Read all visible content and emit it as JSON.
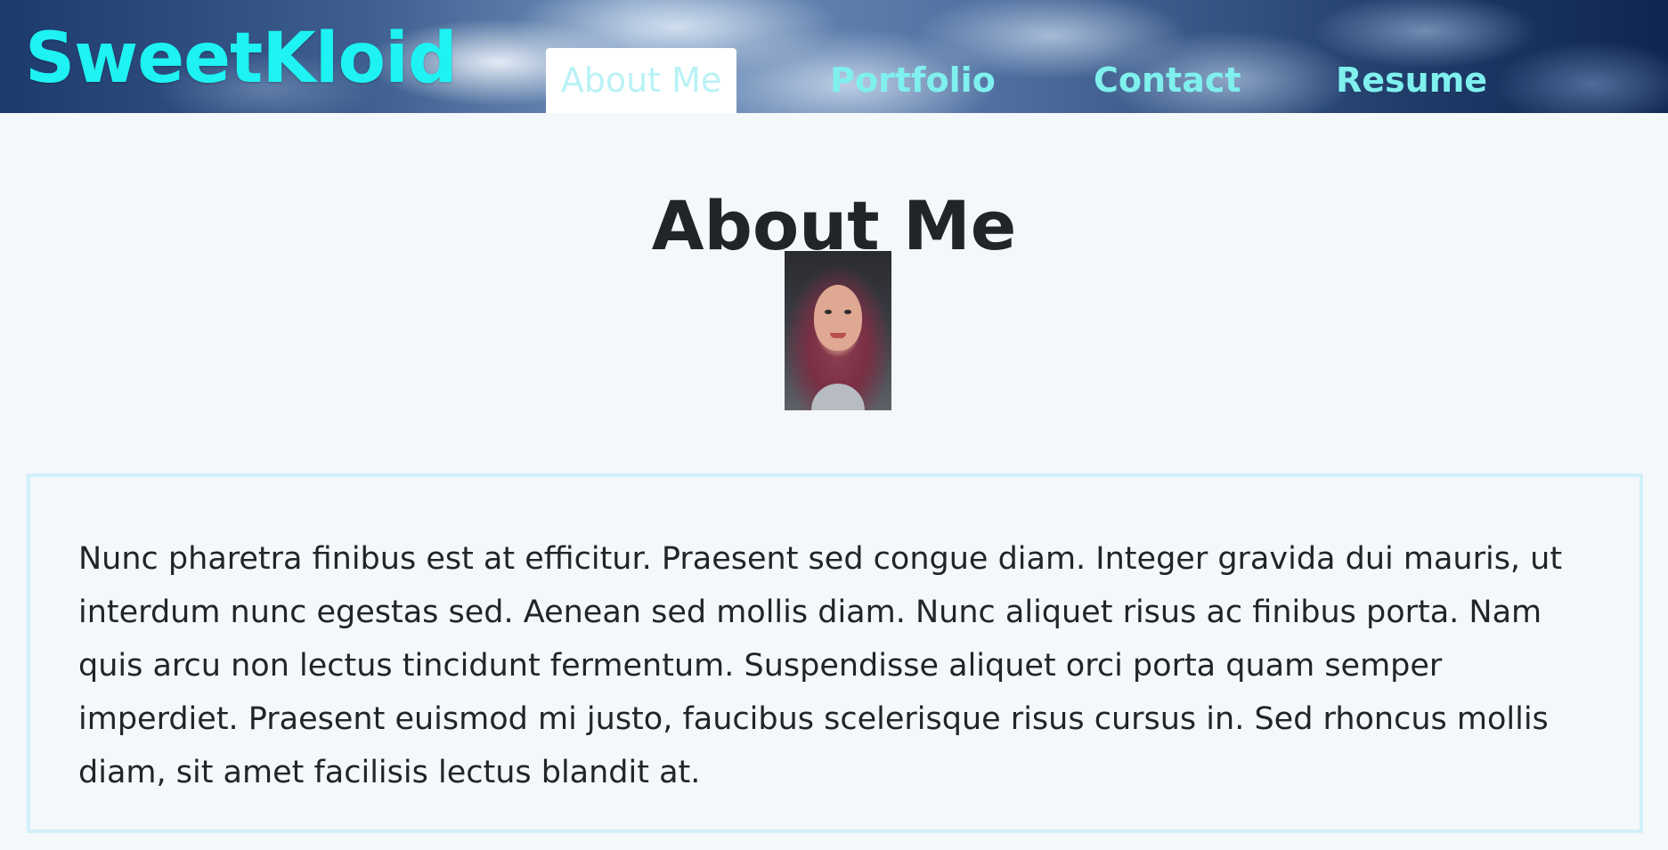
{
  "header": {
    "brand": "SweetKloid",
    "nav": [
      {
        "label": "About Me",
        "active": true
      },
      {
        "label": "Portfolio",
        "active": false
      },
      {
        "label": "Contact",
        "active": false
      },
      {
        "label": "Resume",
        "active": false
      }
    ]
  },
  "main": {
    "title": "About Me",
    "profile_image": "portrait-photo",
    "about_text": "Nunc pharetra finibus est at efficitur. Praesent sed congue diam. Integer gravida dui mauris, ut interdum nunc egestas sed. Aenean sed mollis diam. Nunc aliquet risus ac finibus porta. Nam quis arcu non lectus tincidunt fermentum. Suspendisse aliquet orci porta quam semper imperdiet. Praesent euismod mi justo, faucibus scelerisque risus cursus in. Sed rhoncus mollis diam, sit amet facilisis lectus blandit at."
  },
  "colors": {
    "brand": "#1ef2f2",
    "nav_text": "#7ff0ee",
    "active_tab_bg": "#ffffff",
    "page_bg": "#f4f8fb",
    "box_border": "#d2f0fa"
  }
}
